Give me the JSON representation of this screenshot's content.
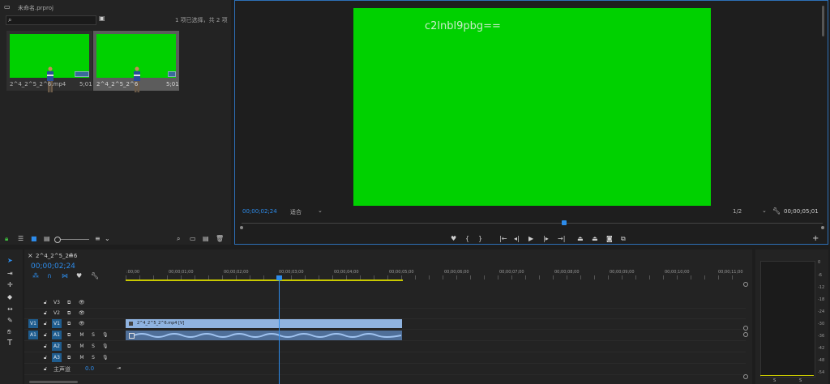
{
  "project": {
    "title": "未命名.prproj",
    "selection_status": "1 项已选择，共 2 项",
    "items": [
      {
        "name": "2^4_2^5_2^6.mp4",
        "duration": "5;01"
      },
      {
        "name": "2^4_2^5_2^6",
        "duration": "5;01"
      }
    ]
  },
  "monitor": {
    "overlay_text": "c2lnbl9pbg==",
    "timecode": "00;00;02;24",
    "fit_label": "适合",
    "resolution": "1/2",
    "duration": "00;00;05;01",
    "video_color": "#00d100"
  },
  "timeline": {
    "tab_label": "2^4_2^5_2^6",
    "timecode": "00;00;02;24",
    "ruler": [
      ":00;00",
      "00;00;01;00",
      "00;00;02;00",
      "00;00;03;00",
      "00;00;04;00",
      "00;00;05;00",
      "00;00;06;00",
      "00;00;07;00",
      "00;00;08;00",
      "00;00;09;00",
      "00;00;10;00",
      "00;00;11;00"
    ],
    "clip_label": "2^4_2^5_2^6.mp4 [V]",
    "tracks": {
      "v3": "V3",
      "v2": "V2",
      "v1src": "V1",
      "v1": "V1",
      "a1src": "A1",
      "a1": "A1",
      "a2": "A2",
      "a3": "A3",
      "m": "M",
      "s": "S"
    },
    "master_label": "主声道",
    "master_value": "0.0"
  },
  "meter": {
    "scale": [
      "0",
      "-6",
      "-12",
      "-18",
      "-24",
      "-30",
      "-36",
      "-42",
      "-48",
      "-54"
    ],
    "channels": [
      "S",
      "S"
    ]
  },
  "colors": {
    "accent": "#2d8ceb",
    "clip_video": "#8fb3e0",
    "clip_audio": "#4f6f99",
    "work_area": "#c9c900"
  }
}
